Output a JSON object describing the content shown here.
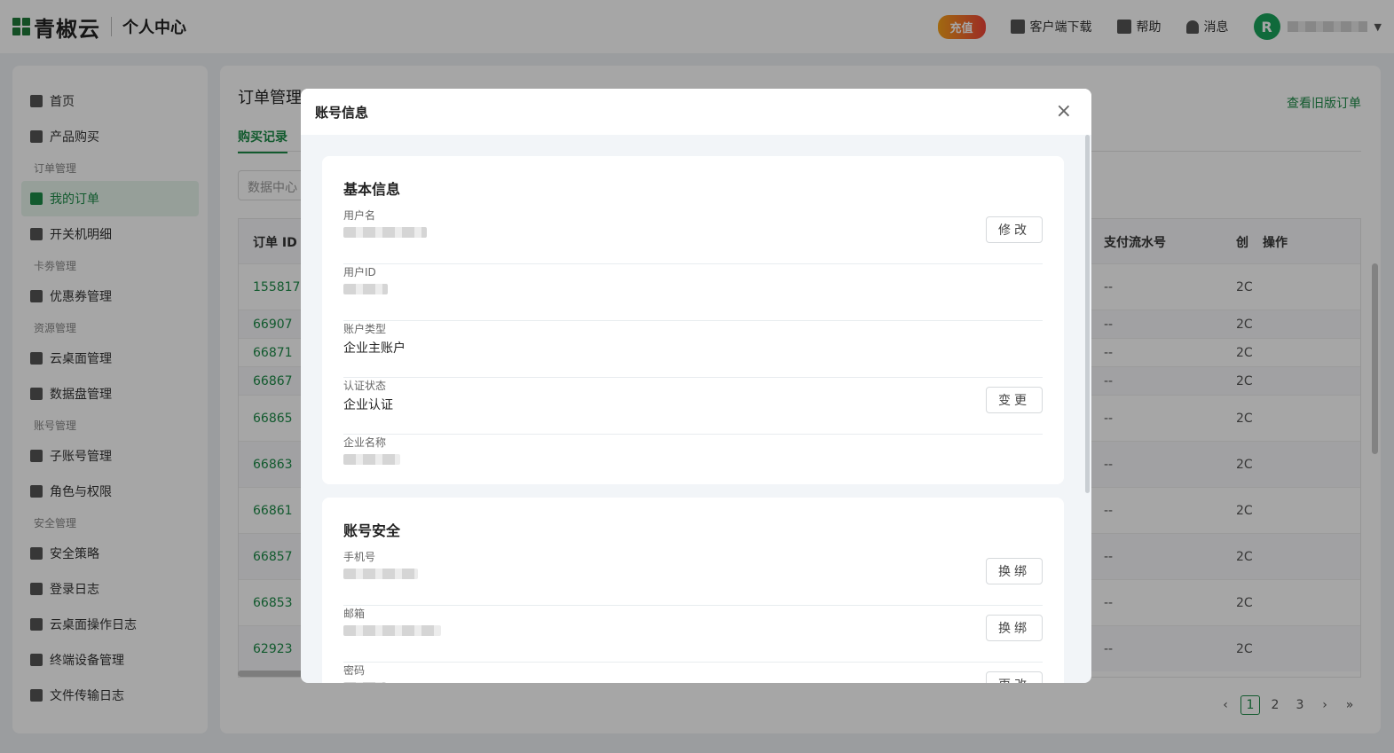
{
  "header": {
    "logo_text": "青椒云",
    "center_title": "个人中心",
    "recharge": "充值",
    "download": "客户端下载",
    "help": "帮助",
    "messages": "消息",
    "avatar_letter": "R"
  },
  "sidebar": {
    "items": [
      {
        "label": "首页",
        "icon": "home-icon"
      },
      {
        "label": "产品购买",
        "icon": "cart-icon"
      },
      {
        "group": "订单管理"
      },
      {
        "label": "我的订单",
        "icon": "order-icon",
        "active": true
      },
      {
        "label": "开关机明细",
        "icon": "list-icon"
      },
      {
        "group": "卡劵管理"
      },
      {
        "label": "优惠券管理",
        "icon": "coupon-icon"
      },
      {
        "group": "资源管理"
      },
      {
        "label": "云桌面管理",
        "icon": "desktop-icon"
      },
      {
        "label": "数据盘管理",
        "icon": "disk-icon"
      },
      {
        "group": "账号管理"
      },
      {
        "label": "子账号管理",
        "icon": "users-icon"
      },
      {
        "label": "角色与权限",
        "icon": "role-icon"
      },
      {
        "group": "安全管理"
      },
      {
        "label": "安全策略",
        "icon": "layers-icon"
      },
      {
        "label": "登录日志",
        "icon": "log-icon"
      },
      {
        "label": "云桌面操作日志",
        "icon": "oplog-icon"
      },
      {
        "label": "终端设备管理",
        "icon": "device-icon"
      },
      {
        "label": "文件传输日志",
        "icon": "file-icon"
      }
    ]
  },
  "main": {
    "title": "订单管理",
    "old_orders_link": "查看旧版订单",
    "tab": "购买记录",
    "search_placeholder": "数据中心",
    "columns": {
      "order_id": "订单 ID",
      "flow_no": "支付流水号",
      "created": "创",
      "action": "操作"
    },
    "rows": [
      {
        "id": "155817",
        "flow": "--",
        "created": "2C"
      },
      {
        "id": "66907",
        "flow": "--",
        "created": "2C"
      },
      {
        "id": "66871",
        "flow": "--",
        "created": "2C"
      },
      {
        "id": "66867",
        "flow": "--",
        "created": "2C"
      },
      {
        "id": "66865",
        "flow": "--",
        "created": "2C"
      },
      {
        "id": "66863",
        "flow": "--",
        "created": "2C"
      },
      {
        "id": "66861",
        "flow": "--",
        "created": "2C"
      },
      {
        "id": "66857",
        "flow": "--",
        "created": "2C"
      },
      {
        "id": "66853",
        "flow": "--",
        "created": "2C"
      },
      {
        "id": "62923",
        "flow": "--",
        "created": "2C"
      }
    ],
    "pager": {
      "pages": [
        "1",
        "2",
        "3"
      ],
      "current": "1",
      "prev": "‹",
      "next": "›",
      "last": "»"
    }
  },
  "modal": {
    "title": "账号信息",
    "close": "×",
    "basic": {
      "title": "基本信息",
      "username_label": "用户名",
      "modify_btn": "修改",
      "userid_label": "用户ID",
      "account_type_label": "账户类型",
      "account_type_value": "企业主账户",
      "auth_label": "认证状态",
      "auth_value": "企业认证",
      "change_btn": "变更",
      "company_label": "企业名称"
    },
    "security": {
      "title": "账号安全",
      "phone_label": "手机号",
      "rebind_btn": "换绑",
      "email_label": "邮箱",
      "rebind_btn2": "换绑",
      "password_label": "密码",
      "change_pwd_btn": "更改"
    }
  }
}
